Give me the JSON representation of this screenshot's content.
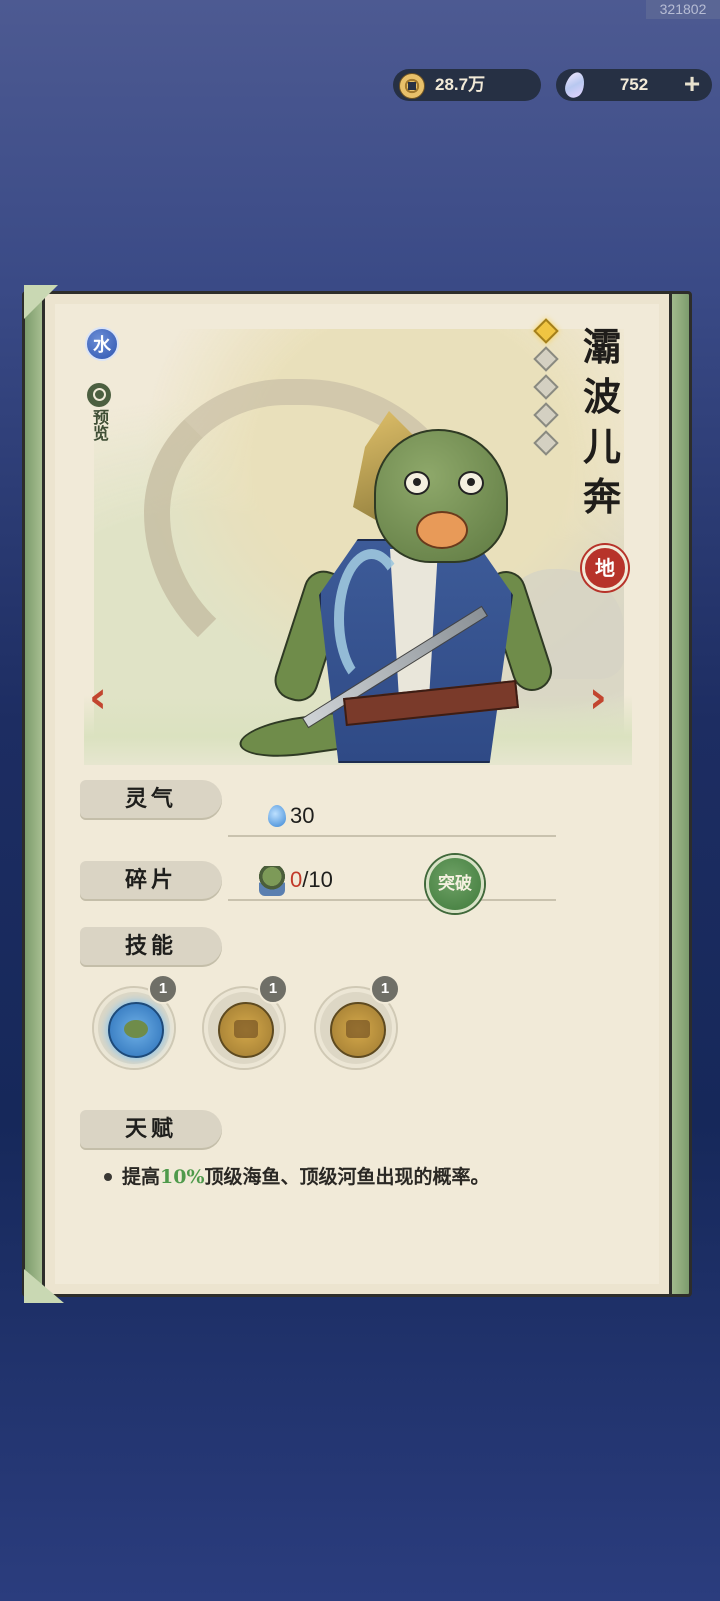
{
  "header": {
    "uid": "321802",
    "coins": "28.7万",
    "gems": "752",
    "plus_label": "+"
  },
  "character": {
    "element": "水",
    "preview_label": "预览",
    "name_chars": [
      "灞",
      "波",
      "儿",
      "奔"
    ],
    "stars_total": 5,
    "stars_lit": 1,
    "rank": "地"
  },
  "nav": {
    "prev": "‹",
    "next": "›"
  },
  "stats": {
    "spirit_label": "灵气",
    "spirit_value": "30",
    "shard_label": "碎片",
    "shard_current": "0",
    "shard_total": "/10",
    "breakthrough_label": "突破"
  },
  "skills": {
    "label": "技能",
    "items": [
      {
        "level": "1",
        "icon": "fish-portrait-skill-icon"
      },
      {
        "level": "1",
        "icon": "fishing-rod-skill-icon"
      },
      {
        "level": "1",
        "icon": "hammer-skill-icon"
      }
    ]
  },
  "talent": {
    "label": "天赋",
    "text_before": "提高",
    "text_highlight": "10%",
    "text_after": "顶级海鱼、顶级河鱼出现的概率。",
    "highlight_color": "#4f9a4b"
  }
}
